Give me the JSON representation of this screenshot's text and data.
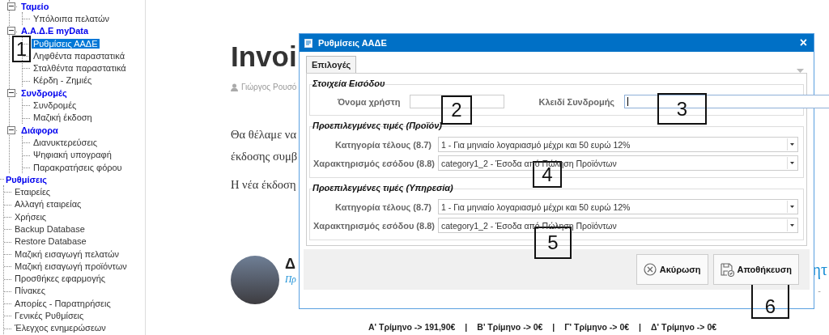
{
  "tree": [
    {
      "children": [
        {
          "label": "Ταμείο",
          "expanded": true,
          "children": [
            {
              "label": "Υπόλοιπα πελατών",
              "selected": false
            }
          ]
        },
        {
          "label": "Α.Α.Δ.Ε myData",
          "expanded": true,
          "children": [
            {
              "label": "Ρυθμίσεις ΑΑΔΕ",
              "selected": true
            },
            {
              "label": "Ληφθέντα παραστατικά",
              "selected": false
            },
            {
              "label": "Σταλθέντα παραστατικά",
              "selected": false
            },
            {
              "label": "Κέρδη - Ζημιές",
              "selected": false
            }
          ]
        },
        {
          "label": "Συνδρομές",
          "expanded": true,
          "children": [
            {
              "label": "Συνδρομές",
              "selected": false
            },
            {
              "label": "Μαζική έκδοση",
              "selected": false
            }
          ]
        },
        {
          "label": "Διάφορα",
          "expanded": true,
          "children": [
            {
              "label": "Διανυκτερεύσεις",
              "selected": false
            },
            {
              "label": "Ψηφιακή υπογραφή",
              "selected": false
            },
            {
              "label": "Παρακρατήσεις φόρου",
              "selected": false
            }
          ]
        }
      ]
    },
    {
      "label": "Ρυθμίσεις",
      "children": [
        {
          "label": "Εταιρείες",
          "selected": false
        },
        {
          "label": "Αλλαγή εταιρείας",
          "selected": false
        },
        {
          "label": "Χρήσεις",
          "selected": false
        },
        {
          "label": "Backup Database",
          "selected": false
        },
        {
          "label": "Restore Database",
          "selected": false
        },
        {
          "label": "Μαζική εισαγωγή πελατών",
          "selected": false
        },
        {
          "label": "Μαζική εισαγωγή προϊόντων",
          "selected": false
        },
        {
          "label": "Προσθήκες εφαρμογής",
          "selected": false
        },
        {
          "label": "Πίνακες",
          "selected": false
        },
        {
          "label": "Απορίες - Παρατηρήσεις",
          "selected": false
        },
        {
          "label": "Γενικές Ρυθμίσεις",
          "selected": false
        },
        {
          "label": "Έλεγχος ενημερώσεων",
          "selected": false
        }
      ]
    }
  ],
  "page": {
    "title": "Invoi",
    "author": "Γιώργος Ρουσό",
    "paragraphs": [
      "Θα θέλαμε να",
      "έκδοσης συμβ",
      "Η νέα έκδοση"
    ],
    "author_name": "Δ",
    "author_link": "Πρ",
    "right_fragment": "ητ",
    "right_dash": "-"
  },
  "footer": [
    "Α' Τρίμηνο -> 191,90€",
    "|",
    "Β' Τρίμηνο -> 0€",
    "|",
    "Γ' Τρίμηνο -> 0€",
    "|",
    "Δ' Τρίμηνο -> 0€"
  ],
  "dialog": {
    "title": "Ρυθμίσεις ΑΑΔΕ",
    "close": "×",
    "tabs": [
      {
        "label": "Επιλογές",
        "selected": true
      }
    ],
    "groups": [
      {
        "title": "Στοιχεία Εισόδου",
        "fields": [
          {
            "kind": "text",
            "label": "Όνομα χρήστη",
            "focused": false
          },
          {
            "kind": "text",
            "label": "Κλειδί Συνδρομής",
            "focused": true
          }
        ]
      },
      {
        "title": "Προεπιλεγμένες τιμές (Προϊόν)",
        "fields": [
          {
            "kind": "combo",
            "label": "Κατηγορία τέλους (8.7)",
            "value": "1 - Για μηνιαίο λογαριασμό μέχρι και 50 ευρώ 12%"
          },
          {
            "kind": "combo",
            "label": "Χαρακτηρισμός εσόδου (8.8)",
            "value": "category1_2 - Έσοδα από Πώληση Προϊόντων"
          }
        ]
      },
      {
        "title": "Προεπιλεγμένες τιμές (Υπηρεσία)",
        "fields": [
          {
            "kind": "combo",
            "label": "Κατηγορία τέλους (8.7)",
            "value": "1 - Για μηνιαίο λογαριασμό μέχρι και 50 ευρώ 12%"
          },
          {
            "kind": "combo",
            "label": "Χαρακτηρισμός εσόδου (8.8)",
            "value": "category1_2 - Έσοδα από Πώληση Προϊόντων"
          }
        ]
      }
    ],
    "buttons": [
      {
        "kind": "cancel",
        "label": "Ακύρωση"
      },
      {
        "kind": "save",
        "label": "Αποθήκευση"
      }
    ]
  },
  "callouts": [
    "1",
    "2",
    "3",
    "4",
    "5",
    "6"
  ]
}
